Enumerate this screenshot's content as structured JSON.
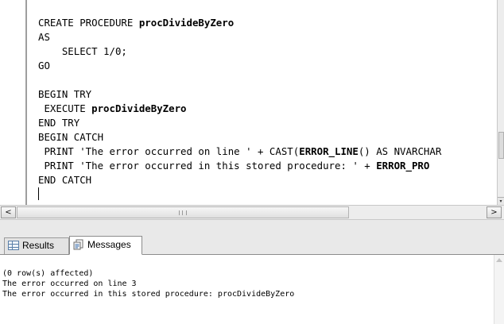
{
  "editor": {
    "lines": [
      {
        "parts": [
          {
            "t": "CREATE PROCEDURE ",
            "c": "kw"
          },
          {
            "t": "procDivideByZero",
            "c": "fn"
          }
        ]
      },
      {
        "parts": [
          {
            "t": "AS",
            "c": "kw"
          }
        ]
      },
      {
        "parts": [
          {
            "t": "    SELECT 1/0;",
            "c": "kw"
          }
        ]
      },
      {
        "parts": [
          {
            "t": "GO",
            "c": "kw"
          }
        ]
      },
      {
        "parts": []
      },
      {
        "parts": [
          {
            "t": "BEGIN TRY",
            "c": "kw"
          }
        ]
      },
      {
        "parts": [
          {
            "t": " EXECUTE ",
            "c": "kw"
          },
          {
            "t": "procDivideByZero",
            "c": "fn"
          }
        ]
      },
      {
        "parts": [
          {
            "t": "END TRY",
            "c": "kw"
          }
        ]
      },
      {
        "parts": [
          {
            "t": "BEGIN CATCH",
            "c": "kw"
          }
        ]
      },
      {
        "parts": [
          {
            "t": " PRINT 'The error occurred on line ' + CAST(",
            "c": "kw"
          },
          {
            "t": "ERROR_LINE",
            "c": "fn"
          },
          {
            "t": "() AS NVARCHAR",
            "c": "kw"
          }
        ]
      },
      {
        "parts": [
          {
            "t": " PRINT 'The error occurred in this stored procedure: ' + ",
            "c": "kw"
          },
          {
            "t": "ERROR_PRO",
            "c": "fn"
          }
        ]
      },
      {
        "parts": [
          {
            "t": "END CATCH",
            "c": "kw"
          }
        ]
      },
      {
        "parts": [],
        "cursor": true
      }
    ]
  },
  "hscroll": {
    "left_arrow": "<",
    "right_arrow": ">",
    "grip_icon": "scroll-grip-icon"
  },
  "vscroll": {
    "down_arrow": "▾"
  },
  "tabs": {
    "results_label": "Results",
    "messages_label": "Messages",
    "active": "messages"
  },
  "messages": {
    "lines": [
      "(0 row(s) affected)",
      "The error occurred on line 3",
      "The error occurred in this stored procedure: procDivideByZero"
    ]
  }
}
